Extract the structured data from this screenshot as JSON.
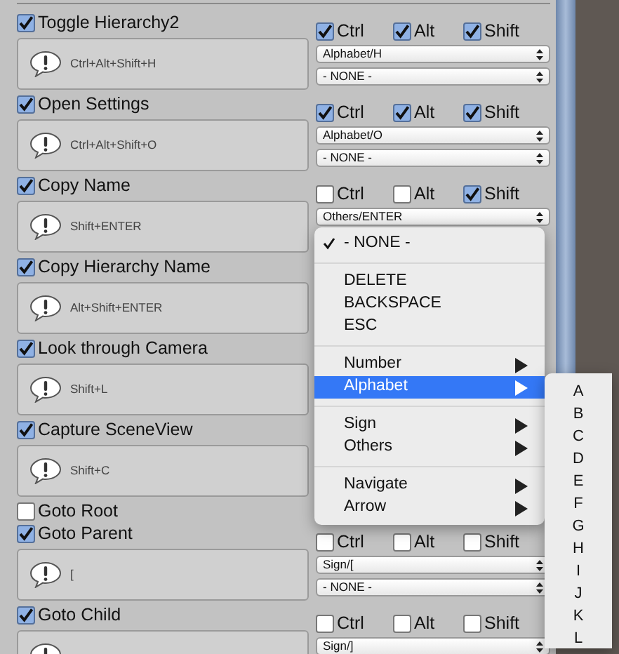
{
  "shortcuts": [
    {
      "label": "Toggle Hierarchy2",
      "checked": true,
      "help": "Ctrl+Alt+Shift+H",
      "modifiers": [
        {
          "label": "Ctrl",
          "checked": true
        },
        {
          "label": "Alt",
          "checked": true
        },
        {
          "label": "Shift",
          "checked": true
        }
      ],
      "dropdowns": [
        "Alphabet/H",
        "- NONE -"
      ]
    },
    {
      "label": "Open Settings",
      "checked": true,
      "help": "Ctrl+Alt+Shift+O",
      "modifiers": [
        {
          "label": "Ctrl",
          "checked": true
        },
        {
          "label": "Alt",
          "checked": true
        },
        {
          "label": "Shift",
          "checked": true
        }
      ],
      "dropdowns": [
        "Alphabet/O",
        "- NONE -"
      ]
    },
    {
      "label": "Copy Name",
      "checked": true,
      "help": "Shift+ENTER",
      "modifiers": [
        {
          "label": "Ctrl",
          "checked": false
        },
        {
          "label": "Alt",
          "checked": false
        },
        {
          "label": "Shift",
          "checked": true
        }
      ],
      "dropdowns": [
        "Others/ENTER"
      ]
    },
    {
      "label": "Copy Hierarchy Name",
      "checked": true,
      "help": "Alt+Shift+ENTER"
    },
    {
      "label": "Look through Camera",
      "checked": true,
      "help": "Shift+L"
    },
    {
      "label": "Capture SceneView",
      "checked": true,
      "help": "Shift+C"
    },
    {
      "label": "Goto Root",
      "checked": false
    },
    {
      "label": "Goto Parent",
      "checked": true,
      "help": "[",
      "modifiers": [
        {
          "label": "Ctrl",
          "checked": false
        },
        {
          "label": "Alt",
          "checked": false
        },
        {
          "label": "Shift",
          "checked": false
        }
      ],
      "dropdowns": [
        "Sign/[",
        "- NONE -"
      ]
    },
    {
      "label": "Goto Child",
      "checked": true,
      "modifiers": [
        {
          "label": "Ctrl",
          "checked": false
        },
        {
          "label": "Alt",
          "checked": false
        },
        {
          "label": "Shift",
          "checked": false
        }
      ],
      "dropdowns": [
        "Sign/]"
      ]
    }
  ],
  "menu": {
    "items": [
      {
        "kind": "item",
        "label": "- NONE -",
        "checked": true,
        "selected": false,
        "submenu": false
      },
      {
        "kind": "separator"
      },
      {
        "kind": "item",
        "label": "DELETE",
        "checked": false,
        "selected": false,
        "submenu": false
      },
      {
        "kind": "item",
        "label": "BACKSPACE",
        "checked": false,
        "selected": false,
        "submenu": false
      },
      {
        "kind": "item",
        "label": "ESC",
        "checked": false,
        "selected": false,
        "submenu": false
      },
      {
        "kind": "separator"
      },
      {
        "kind": "item",
        "label": "Number",
        "checked": false,
        "selected": false,
        "submenu": true
      },
      {
        "kind": "item",
        "label": "Alphabet",
        "checked": false,
        "selected": true,
        "submenu": true
      },
      {
        "kind": "separator"
      },
      {
        "kind": "item",
        "label": "Sign",
        "checked": false,
        "selected": false,
        "submenu": true
      },
      {
        "kind": "item",
        "label": "Others",
        "checked": false,
        "selected": false,
        "submenu": true
      },
      {
        "kind": "separator"
      },
      {
        "kind": "item",
        "label": "Navigate",
        "checked": false,
        "selected": false,
        "submenu": true
      },
      {
        "kind": "item",
        "label": "Arrow",
        "checked": false,
        "selected": false,
        "submenu": true
      }
    ]
  },
  "submenu": {
    "items": [
      "A",
      "B",
      "C",
      "D",
      "E",
      "F",
      "G",
      "H",
      "I",
      "J",
      "K",
      "L"
    ]
  }
}
